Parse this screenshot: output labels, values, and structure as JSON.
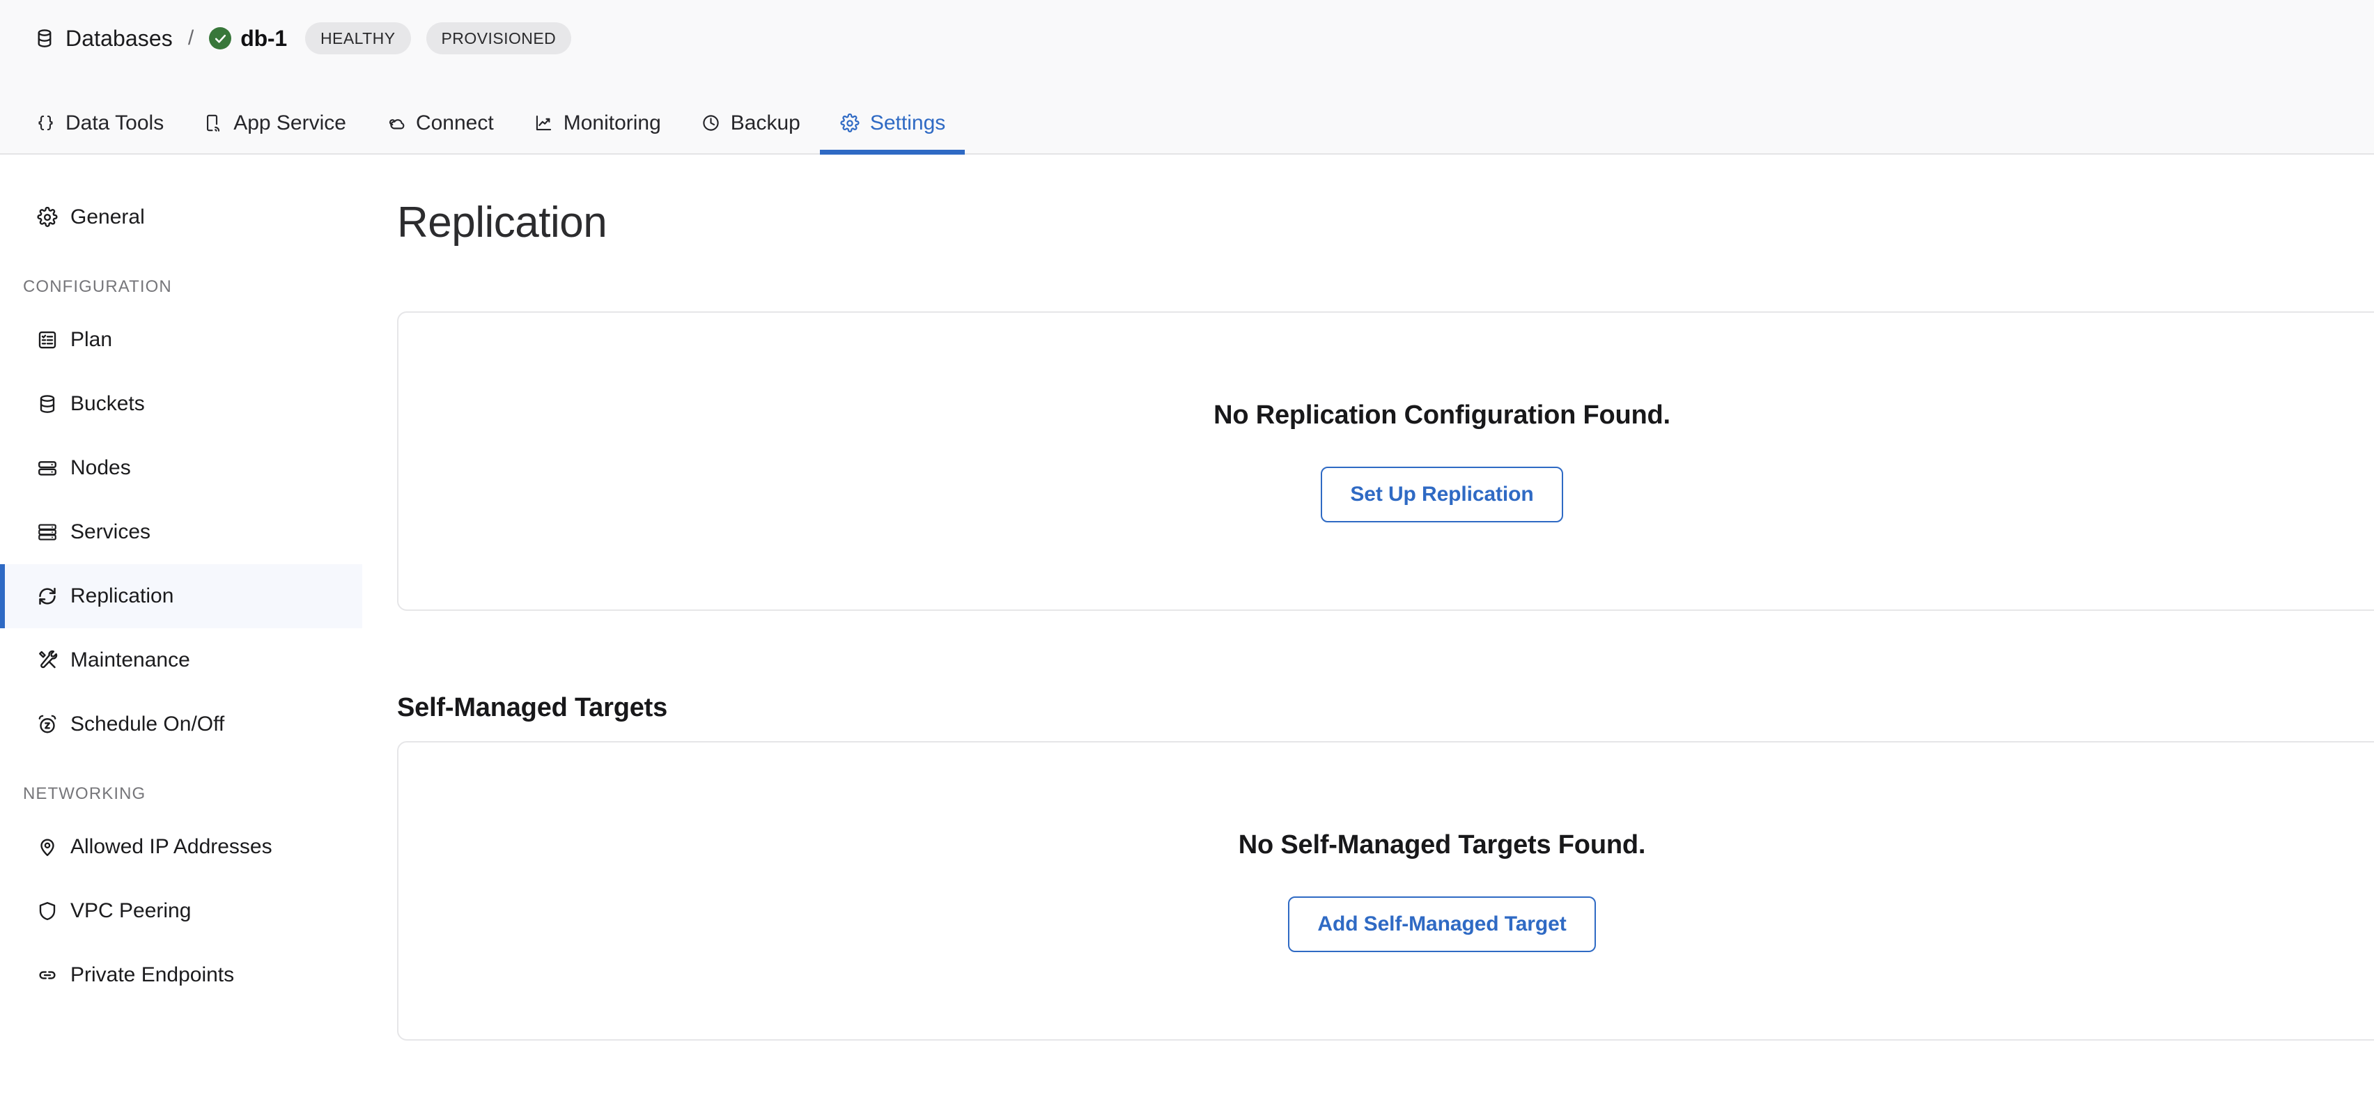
{
  "breadcrumb": {
    "root_label": "Databases",
    "separator": "/",
    "current_label": "db-1",
    "db_icon": "database-icon",
    "health_icon": "check-circle-icon",
    "badges": [
      {
        "label": "HEALTHY"
      },
      {
        "label": "PROVISIONED"
      }
    ]
  },
  "tabs": [
    {
      "label": "Data Tools",
      "icon": "code-braces-icon",
      "active": false
    },
    {
      "label": "App Service",
      "icon": "mobile-signal-icon",
      "active": false
    },
    {
      "label": "Connect",
      "icon": "cloud-link-icon",
      "active": false
    },
    {
      "label": "Monitoring",
      "icon": "chart-line-icon",
      "active": false
    },
    {
      "label": "Backup",
      "icon": "clock-icon",
      "active": false
    },
    {
      "label": "Settings",
      "icon": "gear-icon",
      "active": true
    }
  ],
  "sidebar": {
    "top_items": [
      {
        "label": "General",
        "icon": "gear-icon",
        "selected": false
      }
    ],
    "groups": [
      {
        "title": "CONFIGURATION",
        "items": [
          {
            "label": "Plan",
            "icon": "list-checklist-icon",
            "selected": false
          },
          {
            "label": "Buckets",
            "icon": "database-icon",
            "selected": false
          },
          {
            "label": "Nodes",
            "icon": "server-stack-icon",
            "selected": false
          },
          {
            "label": "Services",
            "icon": "server-rack-icon",
            "selected": false
          },
          {
            "label": "Replication",
            "icon": "refresh-sync-icon",
            "selected": true
          },
          {
            "label": "Maintenance",
            "icon": "tools-icon",
            "selected": false
          },
          {
            "label": "Schedule On/Off",
            "icon": "alarm-clock-icon",
            "selected": false
          }
        ]
      },
      {
        "title": "NETWORKING",
        "items": [
          {
            "label": "Allowed IP Addresses",
            "icon": "map-pin-icon",
            "selected": false
          },
          {
            "label": "VPC Peering",
            "icon": "shield-icon",
            "selected": false
          },
          {
            "label": "Private Endpoints",
            "icon": "link-icon",
            "selected": false
          }
        ]
      }
    ]
  },
  "main": {
    "page_title": "Replication",
    "replication_card": {
      "empty_title": "No Replication Configuration Found.",
      "action_label": "Set Up Replication"
    },
    "self_managed_section": {
      "heading": "Self-Managed Targets",
      "empty_title": "No Self-Managed Targets Found.",
      "action_label": "Add Self-Managed Target"
    }
  },
  "colors": {
    "accent": "#2f6ac4",
    "health_green": "#38773a",
    "header_bg": "#f9f9fa",
    "selected_nav_bg": "#f6f8fd",
    "badge_bg": "#e7e7e9",
    "card_border": "#e6e6e8"
  }
}
